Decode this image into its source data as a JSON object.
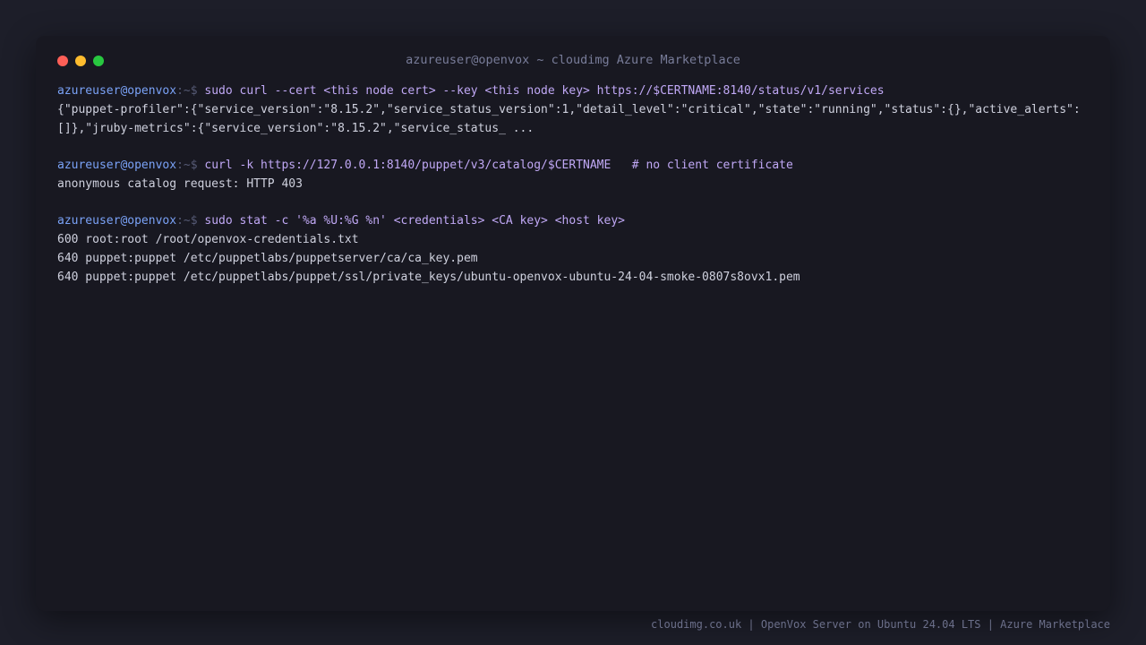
{
  "window": {
    "title": "azureuser@openvox ~ cloudimg Azure Marketplace"
  },
  "terminal": {
    "blocks": [
      {
        "prompt_user": "azureuser@openvox",
        "prompt_path": ":~$",
        "command": "sudo curl --cert <this node cert> --key <this node key> https://$CERTNAME:8140/status/v1/services",
        "output": [
          "{\"puppet-profiler\":{\"service_version\":\"8.15.2\",\"service_status_version\":1,\"detail_level\":\"critical\",\"state\":\"running\",\"status\":{},\"active_alerts\":",
          "[]},\"jruby-metrics\":{\"service_version\":\"8.15.2\",\"service_status_ ..."
        ]
      },
      {
        "prompt_user": "azureuser@openvox",
        "prompt_path": ":~$",
        "command": "curl -k https://127.0.0.1:8140/puppet/v3/catalog/$CERTNAME   # no client certificate",
        "output": [
          "anonymous catalog request: HTTP 403"
        ]
      },
      {
        "prompt_user": "azureuser@openvox",
        "prompt_path": ":~$",
        "command": "sudo stat -c '%a %U:%G %n' <credentials> <CA key> <host key>",
        "output": [
          "600 root:root /root/openvox-credentials.txt",
          "640 puppet:puppet /etc/puppetlabs/puppetserver/ca/ca_key.pem",
          "640 puppet:puppet /etc/puppetlabs/puppet/ssl/private_keys/ubuntu-openvox-ubuntu-24-04-smoke-0807s8ovx1.pem"
        ]
      }
    ]
  },
  "footer": {
    "text": "cloudimg.co.uk | OpenVox Server on Ubuntu 24.04 LTS | Azure Marketplace"
  },
  "colors": {
    "background": "#1d1e29",
    "window": "#181821",
    "prompt_user": "#7aa2f7",
    "command": "#c0a8f5",
    "output": "#cfd1de",
    "close": "#fe5f57",
    "minimize": "#febc2e",
    "maximize": "#28c840"
  }
}
